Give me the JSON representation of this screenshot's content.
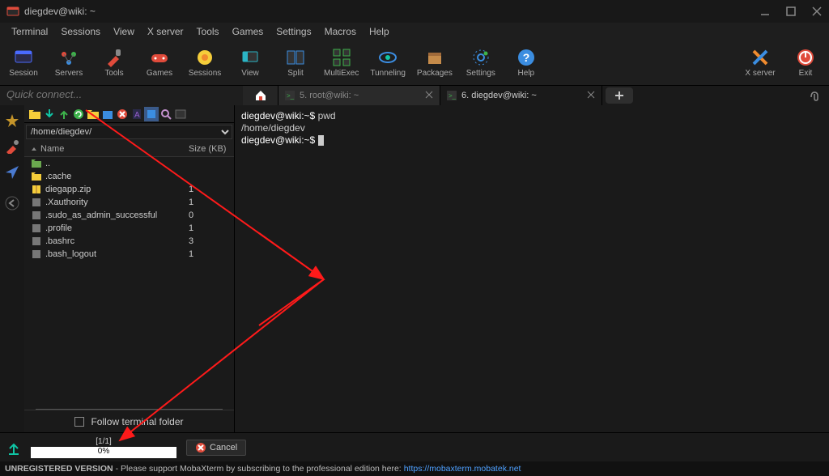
{
  "window": {
    "title": "diegdev@wiki: ~"
  },
  "menu": [
    "Terminal",
    "Sessions",
    "View",
    "X server",
    "Tools",
    "Games",
    "Settings",
    "Macros",
    "Help"
  ],
  "toolbar": [
    {
      "id": "session",
      "label": "Session"
    },
    {
      "id": "servers",
      "label": "Servers"
    },
    {
      "id": "tools",
      "label": "Tools"
    },
    {
      "id": "games",
      "label": "Games"
    },
    {
      "id": "sessions",
      "label": "Sessions"
    },
    {
      "id": "view",
      "label": "View"
    },
    {
      "id": "split",
      "label": "Split"
    },
    {
      "id": "multiexec",
      "label": "MultiExec"
    },
    {
      "id": "tunneling",
      "label": "Tunneling"
    },
    {
      "id": "packages",
      "label": "Packages"
    },
    {
      "id": "settings",
      "label": "Settings"
    },
    {
      "id": "help",
      "label": "Help"
    }
  ],
  "toolbar_right": [
    {
      "id": "xserver",
      "label": "X server"
    },
    {
      "id": "exit",
      "label": "Exit"
    }
  ],
  "quick_connect": {
    "placeholder": "Quick connect..."
  },
  "tabs": [
    {
      "id": "root",
      "label": "5. root@wiki: ~",
      "active": false
    },
    {
      "id": "diegdev",
      "label": "6. diegdev@wiki: ~",
      "active": true
    }
  ],
  "sftp": {
    "path": "/home/diegdev/",
    "header_name": "Name",
    "header_size": "Size (KB)",
    "files": [
      {
        "name": "..",
        "size": "",
        "type": "up"
      },
      {
        "name": ".cache",
        "size": "",
        "type": "folder"
      },
      {
        "name": "diegapp.zip",
        "size": "1",
        "type": "zip"
      },
      {
        "name": ".Xauthority",
        "size": "1",
        "type": "file"
      },
      {
        "name": ".sudo_as_admin_successful",
        "size": "0",
        "type": "file"
      },
      {
        "name": ".profile",
        "size": "1",
        "type": "file"
      },
      {
        "name": ".bashrc",
        "size": "3",
        "type": "file"
      },
      {
        "name": ".bash_logout",
        "size": "1",
        "type": "file"
      }
    ],
    "follow_label": "Follow terminal folder"
  },
  "terminal": {
    "lines": [
      {
        "prompt": "diegdev@wiki:~$",
        "cmd": " pwd"
      },
      {
        "text": "/home/diegdev"
      },
      {
        "prompt": "diegdev@wiki:~$",
        "cursor": true
      }
    ]
  },
  "progress": {
    "count": "[1/1]",
    "percent": "0%",
    "cancel": "Cancel"
  },
  "status": {
    "prefix": "UNREGISTERED VERSION",
    "text": " -  Please support MobaXterm by subscribing to the professional edition here: ",
    "url": "https://mobaxterm.mobatek.net"
  }
}
